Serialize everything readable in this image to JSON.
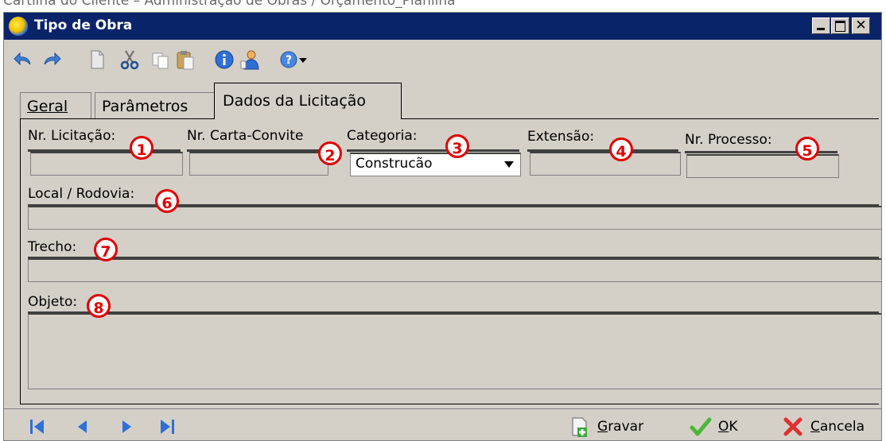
{
  "document_caption": "Cartilha do Cliente – Administração de Obras / Orçamento_Planilha",
  "window": {
    "title": "Tipo de Obra",
    "controls": [
      "minimize",
      "maximize",
      "close"
    ]
  },
  "toolbar": {
    "icons": [
      "undo-icon",
      "redo-icon",
      "new-document-icon",
      "cut-icon",
      "copy-icon",
      "paste-icon",
      "info-icon",
      "user-icon",
      "help-icon",
      "dropdown-arrow-icon"
    ]
  },
  "tabs": [
    {
      "label": "Geral",
      "selected": false
    },
    {
      "label": "Parâmetros",
      "selected": false
    },
    {
      "label": "Dados da Licitação",
      "selected": true
    }
  ],
  "form": {
    "nr_licitacao": {
      "label": "Nr. Licitação:",
      "value": "",
      "marker": "1"
    },
    "nr_carta_convite": {
      "label": "Nr. Carta-Convite",
      "value": "",
      "marker": "2"
    },
    "categoria": {
      "label": "Categoria:",
      "value": "Construcão",
      "marker": "3"
    },
    "extensao": {
      "label": "Extensão:",
      "value": "",
      "marker": "4"
    },
    "nr_processo": {
      "label": "Nr. Processo:",
      "value": "",
      "marker": "5"
    },
    "local_rodovia": {
      "label": "Local / Rodovia:",
      "value": "",
      "marker": "6"
    },
    "trecho": {
      "label": "Trecho:",
      "value": "",
      "marker": "7"
    },
    "objeto": {
      "label": "Objeto:",
      "value": "",
      "marker": "8"
    }
  },
  "navigation": [
    "first-record-icon",
    "previous-record-icon",
    "next-record-icon",
    "last-record-icon"
  ],
  "actions": {
    "gravar": {
      "label_underlined": "G",
      "label_rest": "ravar"
    },
    "ok": {
      "label_underlined": "O",
      "label_rest": "K"
    },
    "cancela": {
      "label_underlined": "C",
      "label_rest": "ancela"
    }
  },
  "colors": {
    "titlebar": "#0a246a",
    "window_bg": "#d4d0c8",
    "marker": "#e00000",
    "nav_blue": "#2e6fd8"
  }
}
